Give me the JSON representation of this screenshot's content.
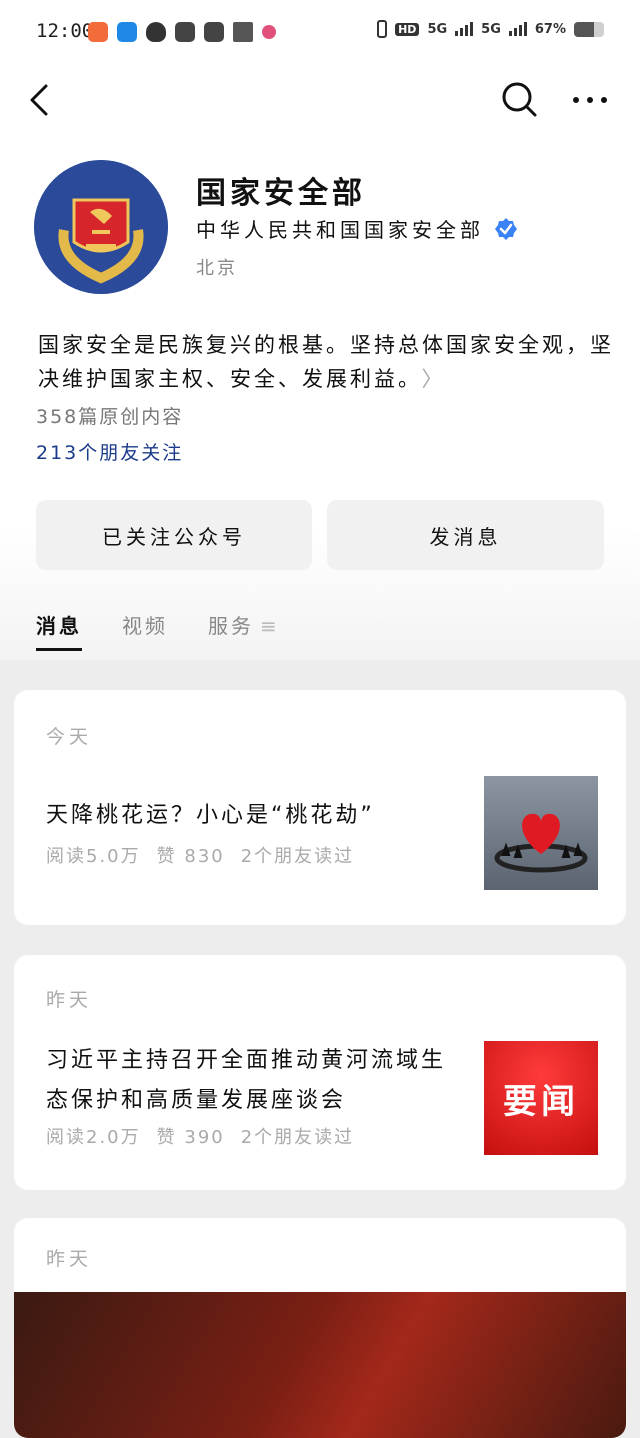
{
  "status_bar": {
    "time": "12:00",
    "network1": "5G",
    "network2": "5G",
    "hd": "HD",
    "battery": "67%"
  },
  "nav": {
    "back_icon": "back-arrow-icon",
    "search_icon": "search-icon",
    "more_icon": "more-icon"
  },
  "profile": {
    "name": "国家安全部",
    "organization": "中华人民共和国国家安全部",
    "location": "北京",
    "intro": "国家安全是民族复兴的根基。坚持总体国家安全观，坚决维护国家主权、安全、发展利益。",
    "original_count": "358篇原创内容",
    "friends_following": "213个朋友关注"
  },
  "actions": {
    "followed_label": "已关注公众号",
    "message_label": "发消息"
  },
  "tabs": [
    {
      "label": "消息",
      "active": true
    },
    {
      "label": "视频",
      "active": false
    },
    {
      "label": "服务",
      "active": false
    }
  ],
  "articles": [
    {
      "day": "今天",
      "title": "天降桃花运？小心是“桃花劫”",
      "reads": "阅读5.0万",
      "likes": "赞 830",
      "friends_read": "2个朋友读过"
    },
    {
      "day": "昨天",
      "title": "习近平主持召开全面推动黄河流域生态保护和高质量发展座谈会",
      "reads": "阅读2.0万",
      "likes": "赞 390",
      "friends_read": "2个朋友读过",
      "thumb_text": "要闻"
    },
    {
      "day": "昨天"
    }
  ],
  "colors": {
    "accent_blue": "#1a3a8a",
    "verified_blue": "#3b82f6",
    "news_red": "#d81e1e"
  }
}
